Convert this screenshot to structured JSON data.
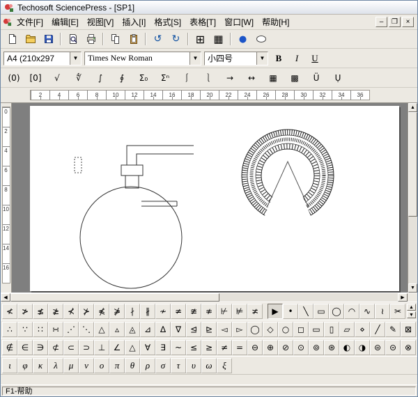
{
  "window": {
    "title": "Techosoft SciencePress - [SP1]",
    "controls": {
      "minimize": "–",
      "restore": "❐",
      "close": "×"
    }
  },
  "menu": {
    "items": [
      "文件[F]",
      "编辑[E]",
      "视图[V]",
      "插入[I]",
      "格式[S]",
      "表格[T]",
      "窗口[W]",
      "帮助[H]"
    ]
  },
  "toolbar_main": {
    "icon_names": [
      "new-document-icon",
      "open-folder-icon",
      "save-floppy-icon",
      "print-preview-icon",
      "printer-icon",
      "copy-icon",
      "paste-clipboard-icon",
      "undo-icon",
      "redo-icon",
      "insert-table-icon",
      "table-grid-icon",
      "insert-object-icon",
      "draw-ellipse-icon"
    ]
  },
  "format_bar": {
    "page_size": "A4  (210x297",
    "font_name": "Times New Roman",
    "font_size": "小四号",
    "bold": "B",
    "italic": "I",
    "underline": "U"
  },
  "math_bar": {
    "buttons": [
      {
        "name": "paren-template",
        "glyph": "(0)"
      },
      {
        "name": "bracket-template",
        "glyph": "[0]"
      },
      {
        "name": "radical",
        "glyph": "√"
      },
      {
        "name": "nth-root",
        "glyph": "∜"
      },
      {
        "name": "integral",
        "glyph": "∫"
      },
      {
        "name": "contour-integral",
        "glyph": "∮"
      },
      {
        "name": "sum-template",
        "glyph": "Σ₀"
      },
      {
        "name": "sum-limits",
        "glyph": "Σⁿ"
      },
      {
        "name": "left-brace",
        "glyph": "⎰"
      },
      {
        "name": "right-brace",
        "glyph": "⎱"
      },
      {
        "name": "arrow-over",
        "glyph": "→"
      },
      {
        "name": "arrow-both",
        "glyph": "↔"
      },
      {
        "name": "matrix",
        "glyph": "▦"
      },
      {
        "name": "matrix-dots",
        "glyph": "▩"
      },
      {
        "name": "accent-umlaut",
        "glyph": "Ü"
      },
      {
        "name": "accent-underdot",
        "glyph": "Ụ"
      }
    ]
  },
  "rulers": {
    "h_numbers": [
      "2",
      "4",
      "6",
      "8",
      "10",
      "12",
      "14",
      "16",
      "18",
      "20",
      "22",
      "24",
      "26",
      "28",
      "30",
      "32",
      "34",
      "36"
    ],
    "v_numbers": [
      "0",
      "2",
      "4",
      "6",
      "8",
      "10",
      "12",
      "14",
      "16"
    ]
  },
  "icons": {
    "undo": "↺",
    "redo": "↻",
    "table": "⊞",
    "table_grid": "▦",
    "insert_object": "●",
    "dropdown_arrow": "▼",
    "scroll_up": "▲",
    "scroll_down": "▼",
    "scroll_left": "◀",
    "scroll_right": "▶"
  },
  "palettes": {
    "row1_left": [
      "≮",
      "≯",
      "≰",
      "≱",
      "⊀",
      "⊁",
      "⋠",
      "⋡",
      "∤",
      "∦",
      "≁",
      "≄",
      "≇",
      "≉",
      "⊬",
      "⊭",
      "≭"
    ],
    "row1_right": [
      "▶",
      "•",
      "╲",
      "▭",
      "◯",
      "◠",
      "∿",
      "≀",
      "✂"
    ],
    "row2_left": [
      "∴",
      "∵",
      "∷",
      "∺",
      "⋰",
      "⋱",
      "△",
      "▵",
      "◬",
      "⊿",
      "∆",
      "∇",
      "⊴",
      "⊵",
      "◅",
      "▻"
    ],
    "row2_right": [
      "◯",
      "◇",
      "○",
      "◻",
      "▭",
      "▯",
      "▱",
      "⋄",
      "╱",
      "✎",
      "⊠"
    ],
    "row3_left": [
      "∉",
      "∈",
      "∋",
      "⊄",
      "⊂",
      "⊃",
      "⊥",
      "∠",
      "△",
      "∀",
      "∃",
      "~",
      "≤",
      "≥",
      "≠",
      "="
    ],
    "row3_right": [
      "⊖",
      "⊕",
      "⊘",
      "⊙",
      "⊚",
      "⊛",
      "◐",
      "◑",
      "⊜",
      "⊝",
      "⊗"
    ],
    "row4_left": [
      "ι",
      "φ",
      "κ",
      "λ",
      "μ",
      "ν",
      "ο",
      "π",
      "θ",
      "ρ",
      "σ",
      "τ",
      "υ",
      "ω",
      "ξ"
    ]
  },
  "status_bar": {
    "text": "F1-帮助"
  },
  "colors": {
    "chrome": "#ece9e2",
    "workspace": "#7f7f7f",
    "object_blue": "#1c55c8"
  }
}
